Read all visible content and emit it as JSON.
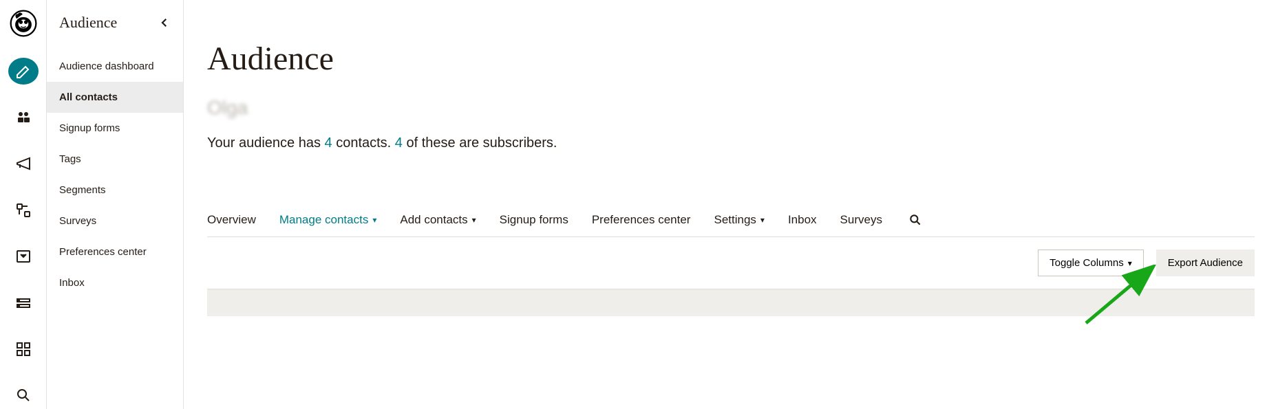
{
  "sidebar": {
    "title": "Audience",
    "items": [
      {
        "label": "Audience dashboard"
      },
      {
        "label": "All contacts"
      },
      {
        "label": "Signup forms"
      },
      {
        "label": "Tags"
      },
      {
        "label": "Segments"
      },
      {
        "label": "Surveys"
      },
      {
        "label": "Preferences center"
      },
      {
        "label": "Inbox"
      }
    ],
    "activeIndex": 1
  },
  "page": {
    "title": "Audience",
    "subName": "Olga",
    "stat_prefix": "Your audience has ",
    "stat_count1": "4",
    "stat_mid": " contacts. ",
    "stat_count2": "4",
    "stat_suffix": " of these are subscribers."
  },
  "tabs": [
    {
      "label": "Overview",
      "dropdown": false
    },
    {
      "label": "Manage contacts",
      "dropdown": true,
      "active": true
    },
    {
      "label": "Add contacts",
      "dropdown": true
    },
    {
      "label": "Signup forms",
      "dropdown": false
    },
    {
      "label": "Preferences center",
      "dropdown": false
    },
    {
      "label": "Settings",
      "dropdown": true
    },
    {
      "label": "Inbox",
      "dropdown": false
    },
    {
      "label": "Surveys",
      "dropdown": false
    }
  ],
  "actions": {
    "toggleColumns": "Toggle Columns",
    "exportAudience": "Export Audience"
  }
}
